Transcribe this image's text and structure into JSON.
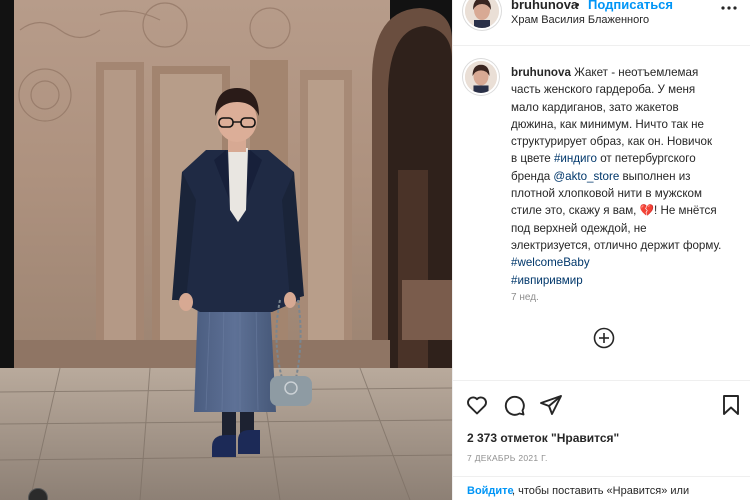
{
  "post": {
    "username": "bruhunova",
    "follow_dot": "•",
    "follow_label": "Подписаться",
    "location": "Храм Василия Блаженного",
    "caption": {
      "line1_rest": " Жакет - неотъемлемая",
      "line2": "часть женского гардероба. У меня",
      "line3": "мало кардиганов, зато жакетов",
      "line4": "дюжина, как минимум. Ничто так не",
      "line5": "структурирует образ, как он. Новичок",
      "line6_pre": "в цвете ",
      "line6_tag": "#индиго",
      "line6_post": " от петербургского",
      "line7_pre": "бренда ",
      "line7_mention": "@akto_store",
      "line7_post": " выполнен из",
      "line8": "плотной хлопковой нити в мужском",
      "line9": "стиле это, скажу я вам, 💔! Не мнётся",
      "line10": "под верхней одеждой, не",
      "line11": "электризуется, отлично держит форму.",
      "hashtag1": "#welcomeBaby",
      "hashtag2": "#ивпиривмир"
    },
    "time_ago": "7 нед.",
    "likes": "2 373 отметок \"Нравится\"",
    "date": "7 ДЕКАБРЬ 2021 Г.",
    "login_link": "Войдите",
    "login_text": ", чтобы поставить «Нравится» или"
  },
  "icons": {
    "more": "more-horizontal-icon",
    "add_comment": "plus-circle-icon",
    "like": "heart-icon",
    "comment": "comment-icon",
    "share": "share-icon",
    "save": "bookmark-icon"
  },
  "colors": {
    "link_blue": "#0095f6",
    "hashtag_blue": "#00376b",
    "muted_gray": "#8e8e8e",
    "jacket_navy": "#1f2a44"
  }
}
